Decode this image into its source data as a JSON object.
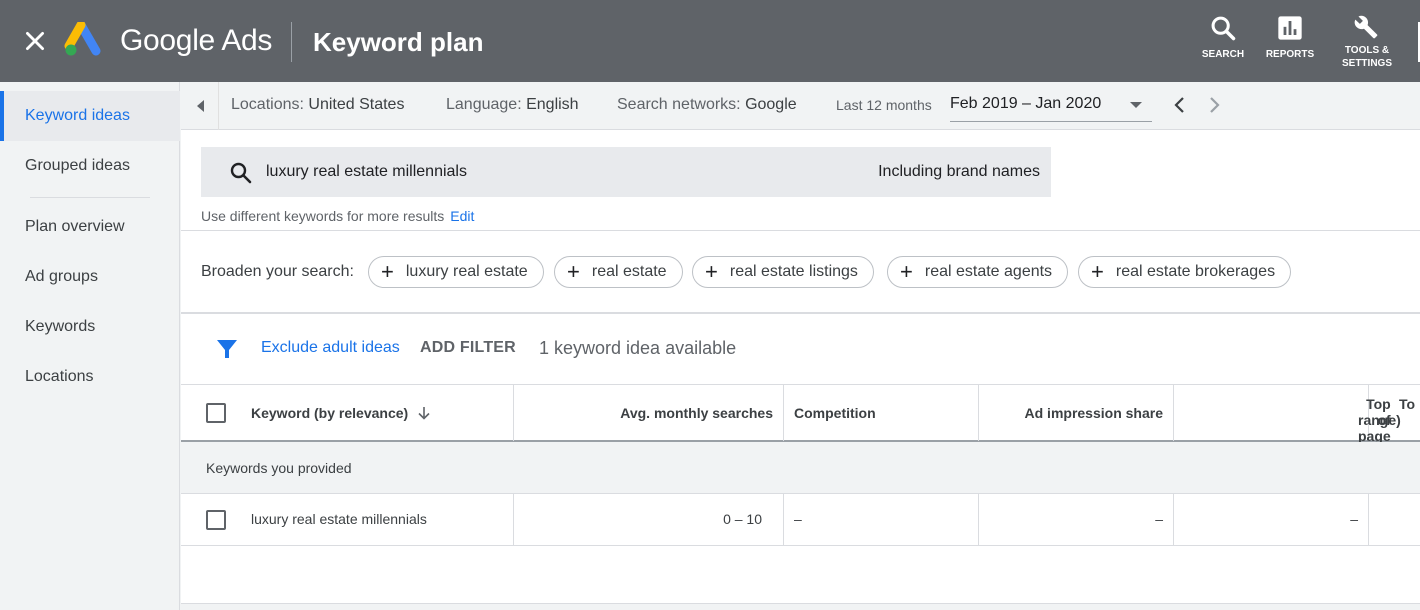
{
  "header": {
    "brand": "Google Ads",
    "page_title": "Keyword plan",
    "buttons": {
      "search": "SEARCH",
      "reports": "REPORTS",
      "tools_line1": "TOOLS &",
      "tools_line2": "SETTINGS"
    }
  },
  "sidebar": {
    "items": [
      {
        "label": "Keyword ideas",
        "active": true
      },
      {
        "label": "Grouped ideas"
      },
      {
        "label": "Plan overview"
      },
      {
        "label": "Ad groups"
      },
      {
        "label": "Keywords"
      },
      {
        "label": "Locations"
      }
    ]
  },
  "topbar": {
    "locations_key": "Locations:",
    "locations_val": "United States",
    "language_key": "Language:",
    "language_val": "English",
    "networks_key": "Search networks:",
    "networks_val": "Google",
    "date_label": "Last 12 months",
    "date_range": "Feb 2019 – Jan 2020"
  },
  "search": {
    "query": "luxury real estate millennials",
    "brand_toggle": "Including brand names",
    "hint": "Use different keywords for more results",
    "edit": "Edit"
  },
  "broaden": {
    "label": "Broaden your search:",
    "chips": [
      "luxury real estate",
      "real estate",
      "real estate listings",
      "real estate agents",
      "real estate brokerages"
    ]
  },
  "filters": {
    "exclude": "Exclude adult ideas",
    "add_filter": "ADD FILTER",
    "available": "1 keyword idea available"
  },
  "table": {
    "columns": [
      "Keyword (by relevance)",
      "Avg. monthly searches",
      "Competition",
      "Ad impression share",
      "Top of page bid (low",
      "range)",
      "To"
    ],
    "group_label": "Keywords you provided",
    "rows": [
      {
        "keyword": "luxury real estate millennials",
        "searches": "0 – 10",
        "competition": "–",
        "impression_share": "–",
        "bid_low": "–"
      }
    ]
  },
  "colors": {
    "header_bg": "#5f6368",
    "accent": "#1a73e8"
  }
}
